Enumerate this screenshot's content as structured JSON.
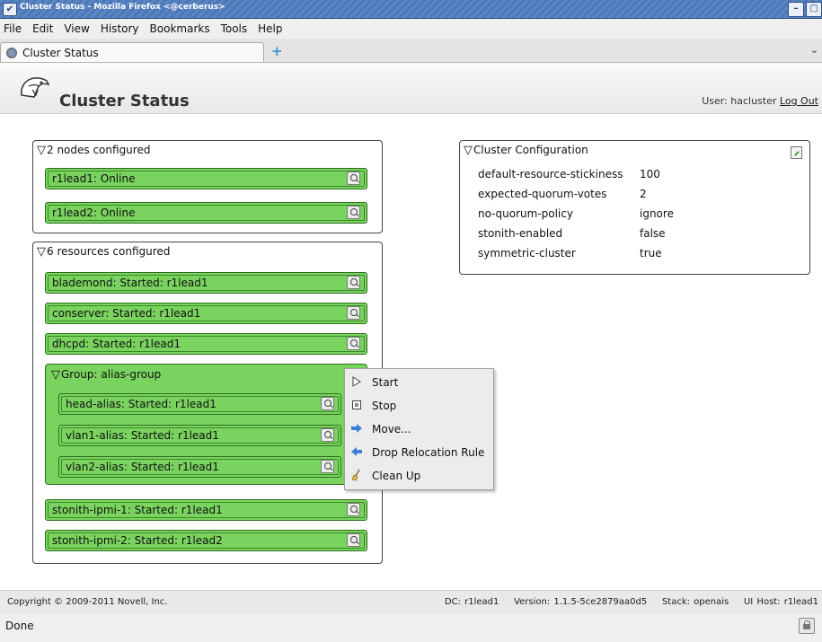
{
  "window": {
    "title": "Cluster Status - Mozilla Firefox <@cerberus>"
  },
  "menu": [
    {
      "label": "File"
    },
    {
      "label": "Edit"
    },
    {
      "label": "View"
    },
    {
      "label": "History"
    },
    {
      "label": "Bookmarks"
    },
    {
      "label": "Tools"
    },
    {
      "label": "Help"
    }
  ],
  "tab": {
    "label": "Cluster Status",
    "new_tab": "+",
    "list_all": "⌄"
  },
  "app": {
    "title": "Cluster Status",
    "user_prefix": "User: hacluster",
    "logout": "Log Out"
  },
  "nodes": {
    "header": "2 nodes configured",
    "items": [
      {
        "label": "r1lead1: Online"
      },
      {
        "label": "r1lead2: Online"
      }
    ]
  },
  "resources": {
    "header": "6 resources configured",
    "items": [
      {
        "label": "blademond: Started: r1lead1"
      },
      {
        "label": "conserver: Started: r1lead1"
      },
      {
        "label": "dhcpd: Started: r1lead1"
      }
    ],
    "group": {
      "header": "Group: alias-group",
      "items": [
        {
          "label": "head-alias: Started: r1lead1"
        },
        {
          "label": "vlan1-alias: Started: r1lead1"
        },
        {
          "label": "vlan2-alias: Started: r1lead1"
        }
      ]
    },
    "after": [
      {
        "label": "stonith-ipmi-1: Started: r1lead1"
      },
      {
        "label": "stonith-ipmi-2: Started: r1lead2"
      }
    ]
  },
  "config": {
    "header": "Cluster Configuration",
    "rows": [
      {
        "key": "default-resource-stickiness",
        "value": "100"
      },
      {
        "key": "expected-quorum-votes",
        "value": "2"
      },
      {
        "key": "no-quorum-policy",
        "value": "ignore"
      },
      {
        "key": "stonith-enabled",
        "value": "false"
      },
      {
        "key": "symmetric-cluster",
        "value": "true"
      }
    ]
  },
  "context_menu": [
    {
      "label": "Start",
      "icon": "play-icon"
    },
    {
      "label": "Stop",
      "icon": "stop-icon"
    },
    {
      "label": "Move...",
      "icon": "arrow-right-icon"
    },
    {
      "label": "Drop Relocation Rule",
      "icon": "arrow-left-icon"
    },
    {
      "label": "Clean Up",
      "icon": "broom-icon"
    }
  ],
  "footer": {
    "copyright": "Copyright © 2009-2011 Novell, Inc.",
    "dc": "DC: r1lead1",
    "version": "Version: 1.1.5-5ce2879aa0d5",
    "stack": "Stack: openais",
    "uihost": "UI Host: r1lead1"
  },
  "status": {
    "text": "Done"
  }
}
